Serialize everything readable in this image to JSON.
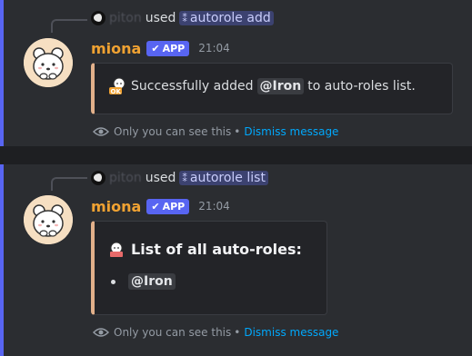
{
  "messages": [
    {
      "reply": {
        "username": "piton",
        "used": "used",
        "command": "autorole add"
      },
      "author": {
        "name": "miona",
        "tag": "APP",
        "time": "21:04"
      },
      "embed": {
        "text_before": "Successfully added",
        "mention": "@Iron",
        "text_after": "to auto-roles list."
      },
      "ephemeral": {
        "text": "Only you can see this",
        "separator": "•",
        "dismiss": "Dismiss message"
      }
    },
    {
      "reply": {
        "username": "piton",
        "used": "used",
        "command": "autorole list"
      },
      "author": {
        "name": "miona",
        "tag": "APP",
        "time": "21:04"
      },
      "embed": {
        "title": "List of all auto-roles:",
        "items": [
          "@Iron"
        ]
      },
      "ephemeral": {
        "text": "Only you can see this",
        "separator": "•",
        "dismiss": "Dismiss message"
      }
    }
  ],
  "colors": {
    "accent": "#5865f2",
    "bot_name": "#f0a232",
    "link": "#00a8fc",
    "embed_bar": "#e2b08a"
  }
}
